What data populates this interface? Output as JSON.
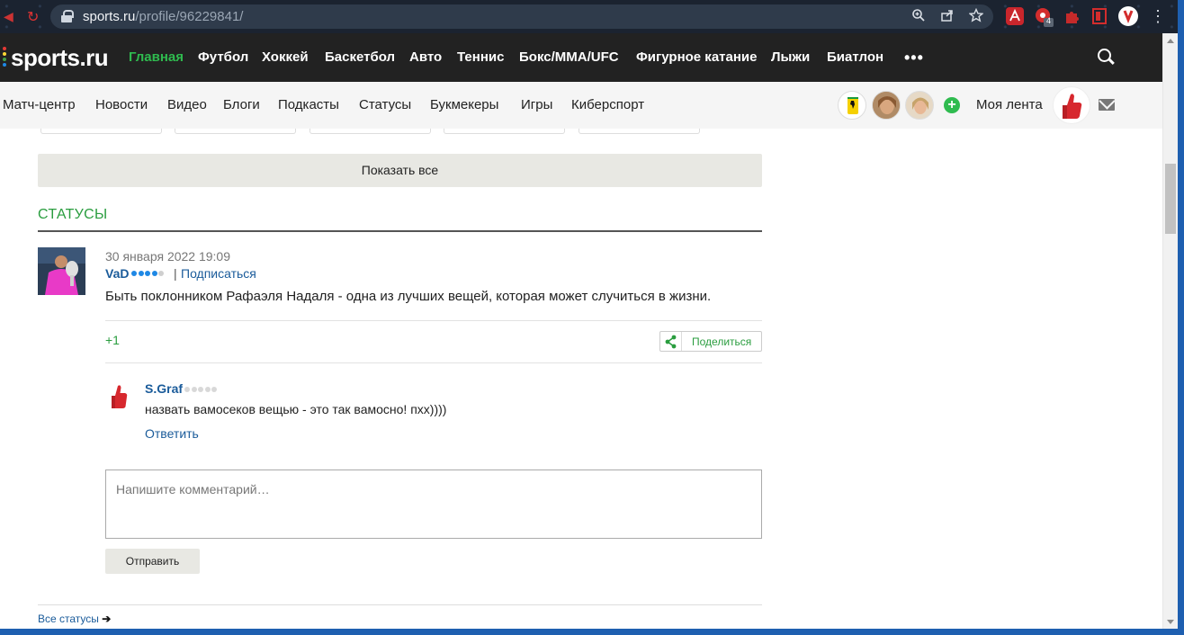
{
  "browser": {
    "url_host": "sports.ru",
    "url_path": "/profile/96229841/",
    "extension_badge": "4"
  },
  "logo": "sports.ru",
  "topnav": {
    "items": [
      "Главная",
      "Футбол",
      "Хоккей",
      "Баскетбол",
      "Авто",
      "Теннис",
      "Бокс/MMA/UFC",
      "Фигурное катание",
      "Лыжи",
      "Биатлон"
    ],
    "more": "•••"
  },
  "subnav": {
    "items": [
      "Матч-центр",
      "Новости",
      "Видео",
      "Блоги",
      "Подкасты",
      "Статусы",
      "Букмекеры",
      "Игры",
      "Киберспорт"
    ],
    "my_feed": "Моя лента"
  },
  "main": {
    "show_all": "Показать все",
    "section_title": "СТАТУСЫ",
    "status": {
      "date": "30 января 2022 19:09",
      "author": "VaD",
      "author_rating_filled": 4,
      "separator": "|",
      "subscribe": "Подписаться",
      "text": "Быть поклонником Рафаэля Надаля - одна из лучших вещей, которая может случиться в жизни.",
      "likes": "+1",
      "share": "Поделиться"
    },
    "comment": {
      "author": "S.Graf",
      "author_rating_filled": 0,
      "text": "назвать вамосеков вещью - это так вамосно! пхх))))",
      "reply": "Ответить"
    },
    "comment_form": {
      "placeholder": "Напишите комментарий…",
      "send": "Отправить"
    },
    "all_statuses": "Все статусы"
  },
  "colors": {
    "brand_green": "#2fbb4f",
    "link_blue": "#1a5b9a",
    "topnav_bg": "#222222"
  }
}
